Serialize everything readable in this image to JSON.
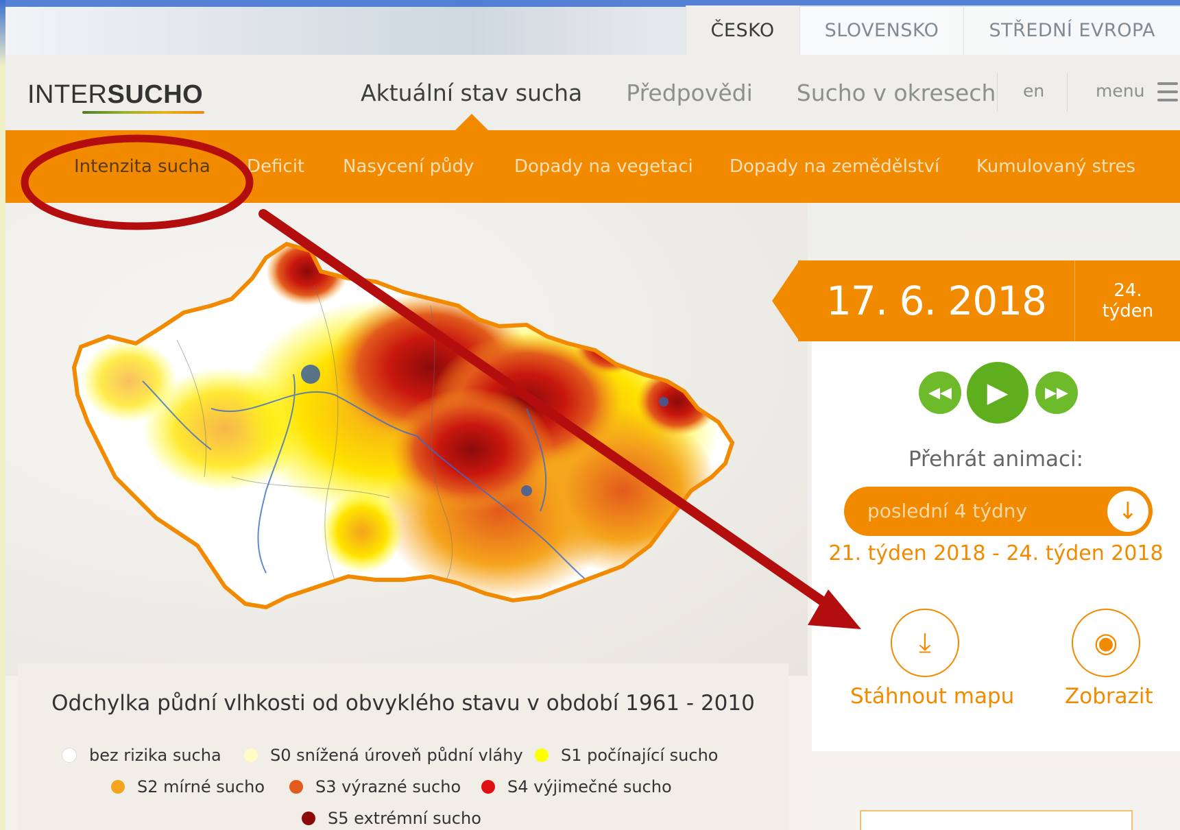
{
  "regions": [
    "ČESKO",
    "SLOVENSKO",
    "STŘEDNÍ EVROPA"
  ],
  "logo": {
    "part1": "INTER",
    "part2": "SUCHO"
  },
  "nav": {
    "items": [
      "Aktuální stav sucha",
      "Předpovědi",
      "Sucho v okresech"
    ],
    "lang": "en",
    "menu": "menu"
  },
  "subnav": [
    "Intenzita sucha",
    "Deficit",
    "Nasycení půdy",
    "Dopady na vegetaci",
    "Dopady na zemědělství",
    "Kumulovaný stres"
  ],
  "date": {
    "main": "17. 6. 2018",
    "week_num": "24.",
    "week_word": "týden"
  },
  "player": {
    "label": "Přehrát animaci:",
    "select_value": "poslední 4 týdny",
    "range": "21. týden 2018 - 24. týden 2018",
    "download": "Stáhnout mapu",
    "show": "Zobrazit"
  },
  "legend": {
    "title": "Odchylka půdní vlhkosti od obvyklého stavu v období 1961 - 2010",
    "items": [
      {
        "label": "bez rizika sucha",
        "color": "#ffffff"
      },
      {
        "label": "S0 snížená úroveň půdní vláhy",
        "color": "#fffcc6"
      },
      {
        "label": "S1 počínající sucho",
        "color": "#ffff00"
      },
      {
        "label": "S2 mírné sucho",
        "color": "#f5a41c"
      },
      {
        "label": "S3 výrazné sucho",
        "color": "#e25a1c"
      },
      {
        "label": "S4 výjimečné sucho",
        "color": "#e00d12"
      },
      {
        "label": "S5 extrémní sucho",
        "color": "#8b0a0a"
      }
    ]
  },
  "colors": {
    "accent": "#f28a00",
    "play": "#6dbb2a",
    "annotation": "#b30d0d"
  }
}
